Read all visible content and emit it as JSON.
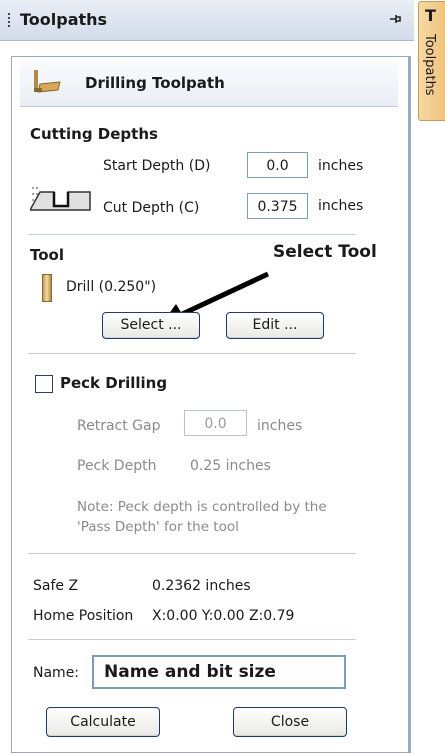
{
  "panel": {
    "title": "Toolpaths",
    "pin_glyph": "⌕",
    "side_tab": "Toolpaths",
    "side_tab_glyph": "T"
  },
  "header": {
    "title": "Drilling Toolpath"
  },
  "cutting_depths": {
    "heading": "Cutting Depths",
    "start_depth_label": "Start Depth (D)",
    "start_depth_value": "0.0",
    "start_unit": "inches",
    "cut_depth_label": "Cut Depth (C)",
    "cut_depth_value": "0.375",
    "cut_unit": "inches"
  },
  "tool": {
    "heading": "Tool",
    "name": "Drill (0.250\")",
    "select_button": "Select ...",
    "edit_button": "Edit ...",
    "annotation": "Select Tool"
  },
  "peck": {
    "label": "Peck Drilling",
    "checked": false,
    "retract_gap_label": "Retract Gap",
    "retract_gap_value": "0.0",
    "retract_unit": "inches",
    "peck_depth_label": "Peck Depth",
    "peck_depth_value": "0.25 inches",
    "note_line1": "Note: Peck depth is controlled by the",
    "note_line2": "'Pass Depth' for the tool"
  },
  "safe": {
    "safe_z_label": "Safe Z",
    "safe_z_value": "0.2362 inches",
    "home_label": "Home Position",
    "home_value": "X:0.00 Y:0.00 Z:0.79"
  },
  "name": {
    "label": "Name:",
    "value": "Name and bit size"
  },
  "actions": {
    "calculate": "Calculate",
    "close": "Close"
  }
}
